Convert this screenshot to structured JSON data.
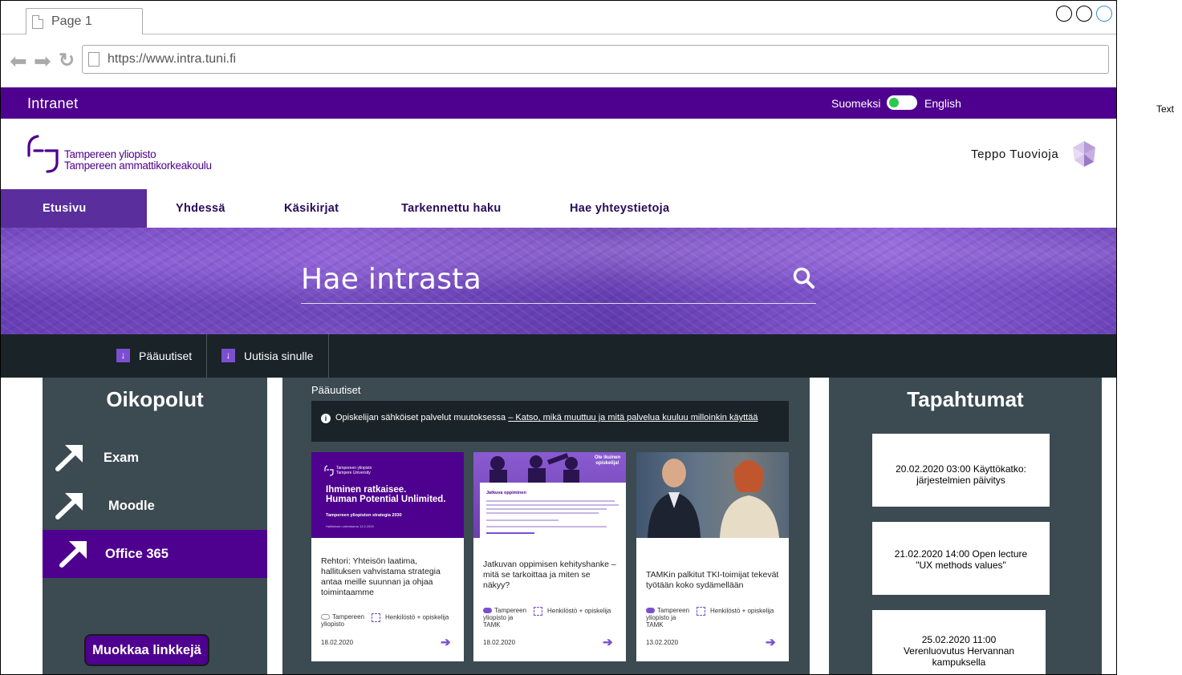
{
  "side_text": "Text",
  "browser": {
    "tab_title": "Page 1",
    "url": "https://www.intra.tuni.fi"
  },
  "topbar": {
    "brand": "Intranet",
    "lang_fi": "Suomeksi",
    "lang_en": "English"
  },
  "header": {
    "logo_line1": "Tampereen yliopisto",
    "logo_line2": "Tampereen ammattikorkeakoulu",
    "user_name": "Teppo Tuovioja"
  },
  "nav": {
    "tabs": [
      "Etusivu",
      "Yhdessä",
      "Käsikirjat",
      "Tarkennettu haku",
      "Hae yhteystietoja"
    ]
  },
  "search": {
    "placeholder": "Hae intrasta"
  },
  "subbar": {
    "items": [
      "Pääuutiset",
      "Uutisia sinulle"
    ]
  },
  "shortcuts": {
    "title": "Oikopolut",
    "items": [
      "Exam",
      "Moodle",
      "Office 365"
    ],
    "edit_label": "Muokkaa linkkejä"
  },
  "news": {
    "heading": "Pääuutiset",
    "notice_text": "Opiskelijan sähköiset palvelut muutoksessa ",
    "notice_link": "– Katso, mikä muuttuu ja mitä palvelua kuuluu milloinkin käyttää",
    "cards": [
      {
        "img_logo": "Tampereen yliopisto\nTampere University",
        "img_headline": "Ihminen ratkaisee.\nHuman Potential Unlimited.",
        "img_sub": "Tampereen yliopiston strategia 2030",
        "img_small": "Hallituksen vahvistama 13.2.2020",
        "title": "Rehtori: Yhteisön laatima, hallituksen vahvistama strategia antaa meille suunnan ja ohjaa toimintaamme",
        "org": "Tampereen yliopisto",
        "audience": "Henkilöstö + opiskelija",
        "date": "18.02.2020"
      },
      {
        "img_badge": "Ole ikuinen opiskelija!",
        "img_panel_title": "Jatkuva oppiminen",
        "title": "Jatkuvan oppimisen kehityshanke – mitä se tarkoittaa ja miten se näkyy?",
        "org": "Tampereen yliopisto ja TAMK",
        "audience": "Henkilöstö + opiskelija",
        "date": "18.02.2020"
      },
      {
        "title": "TAMKin palkitut TKI-toimijat tekevät työtään koko sydämellään",
        "org": "Tampereen yliopisto ja TAMK",
        "audience": "Henkilöstö + opiskelija",
        "date": "13.02.2020"
      }
    ]
  },
  "events": {
    "title": "Tapahtumat",
    "items": [
      {
        "time": "20.02.2020 03:00",
        "text": "Käyttökatko: järjestelmien päivitys"
      },
      {
        "time": "21.02.2020 14:00",
        "text": "Open lecture \"UX methods values\""
      },
      {
        "time": "25.02.2020 11:00",
        "text": "Verenluovutus Hervannan kampuksella"
      }
    ]
  },
  "colors": {
    "brand_purple": "#4e008e",
    "nav_active": "#5a2e9c",
    "dark_bar": "#1a2328",
    "panel_bg": "#3c4a52",
    "accent": "#7b4fd0",
    "toggle_on": "#2cc84d"
  }
}
